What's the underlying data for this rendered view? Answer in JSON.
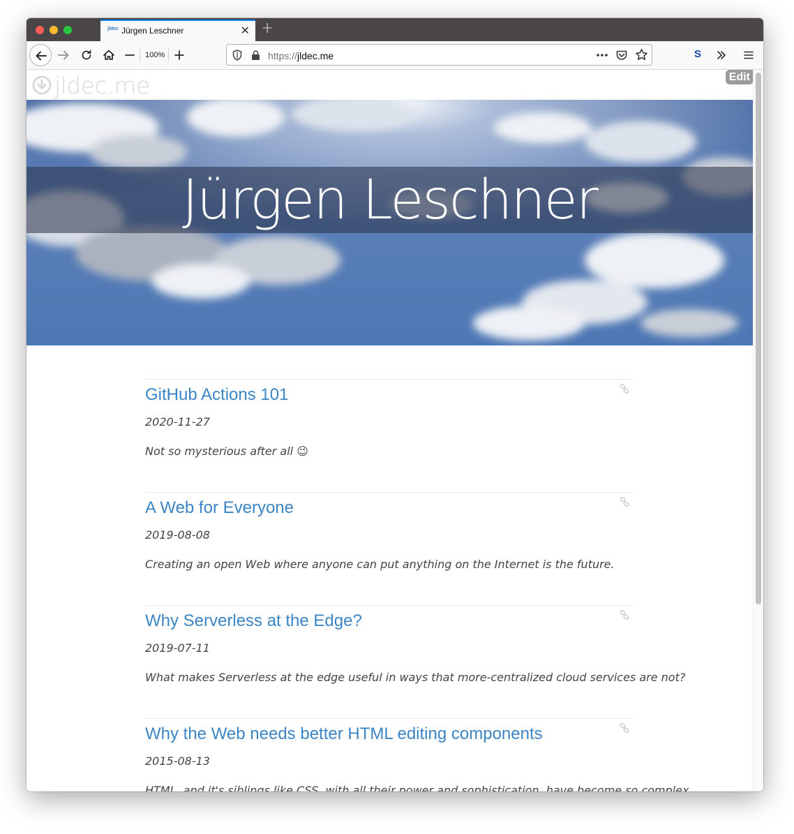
{
  "browser": {
    "tab": {
      "favicon_text": "jldec",
      "title": "Jürgen Leschner"
    },
    "zoom": "100%",
    "url": {
      "scheme": "https://",
      "host": "jldec.me"
    },
    "extension_label": "S"
  },
  "site": {
    "logo_text": "jldec.me",
    "edit_label": "Edit",
    "hero_title": "Jürgen Leschner"
  },
  "posts": [
    {
      "title": "GitHub Actions 101",
      "date": "2020-11-27",
      "summary": "Not so mysterious after all 😉"
    },
    {
      "title": "A Web for Everyone",
      "date": "2019-08-08",
      "summary": "Creating an open Web where anyone can put anything on the Internet is the future."
    },
    {
      "title": "Why Serverless at the Edge?",
      "date": "2019-07-11",
      "summary": "What makes Serverless at the edge useful in ways that more-centralized cloud services are not?"
    },
    {
      "title": "Why the Web needs better HTML editing components",
      "date": "2015-08-13",
      "summary": "HTML, and it's siblings like CSS, with all their power and sophistication, have become so complex"
    }
  ],
  "colors": {
    "link": "#3b85c5",
    "tab_accent": "#0a84ff",
    "edit_bg": "#9a9a9a"
  }
}
